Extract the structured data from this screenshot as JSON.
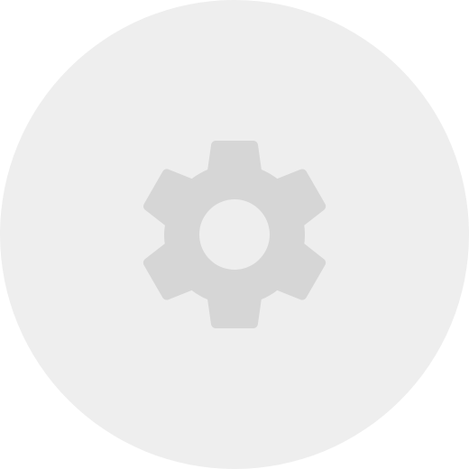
{
  "settings_button": {
    "icon": "gear-icon",
    "background_color": "#eeeeee",
    "icon_color": "#d6d6d6"
  }
}
